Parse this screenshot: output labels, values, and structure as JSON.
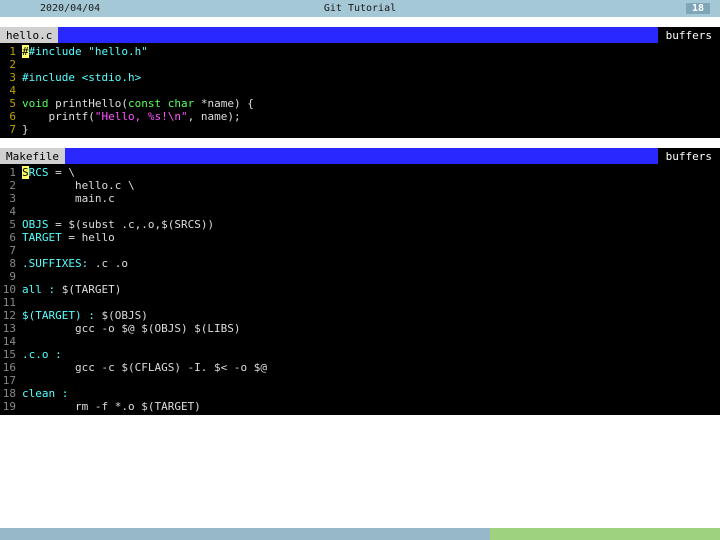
{
  "header": {
    "date": "2020/04/04",
    "title": "Git Tutorial",
    "page": "18"
  },
  "pane1": {
    "filename": "hello.c",
    "buffers_label": "buffers",
    "lines": {
      "l1": "#include \"hello.h\"",
      "l3": "#include <stdio.h>",
      "l5_kw": "void ",
      "l5_fn": "printHello",
      "l5_sig": "(const char *name) {",
      "l5_type": "const char ",
      "l5_arg": "*name",
      "l6_fn": "printf",
      "l6_str": "\"Hello, %s!\\n\"",
      "l6_arg": ", name);",
      "l7": "}"
    }
  },
  "pane2": {
    "filename": "Makefile",
    "buffers_label": "buffers",
    "lines": {
      "l1_lhs": "SRCS",
      "l1_rhs": " = \\",
      "l2": "        hello.c \\",
      "l3": "        main.c",
      "l5_lhs": "OBJS",
      "l5_rhs": " = $(subst .c,.o,$(SRCS))",
      "l6_lhs": "TARGET",
      "l6_rhs": " = hello",
      "l8_lhs": ".SUFFIXES:",
      "l8_rhs": " .c .o",
      "l10_lhs": "all :",
      "l10_rhs": " $(TARGET)",
      "l12_lhs": "$(TARGET) :",
      "l12_rhs": " $(OBJS)",
      "l13": "        gcc -o $@ $(OBJS) $(LIBS)",
      "l15_lhs": ".c.o :",
      "l16": "        gcc -c $(CFLAGS) -I. $< -o $@",
      "l18_lhs": "clean :",
      "l19": "        rm -f *.o $(TARGET)"
    }
  }
}
